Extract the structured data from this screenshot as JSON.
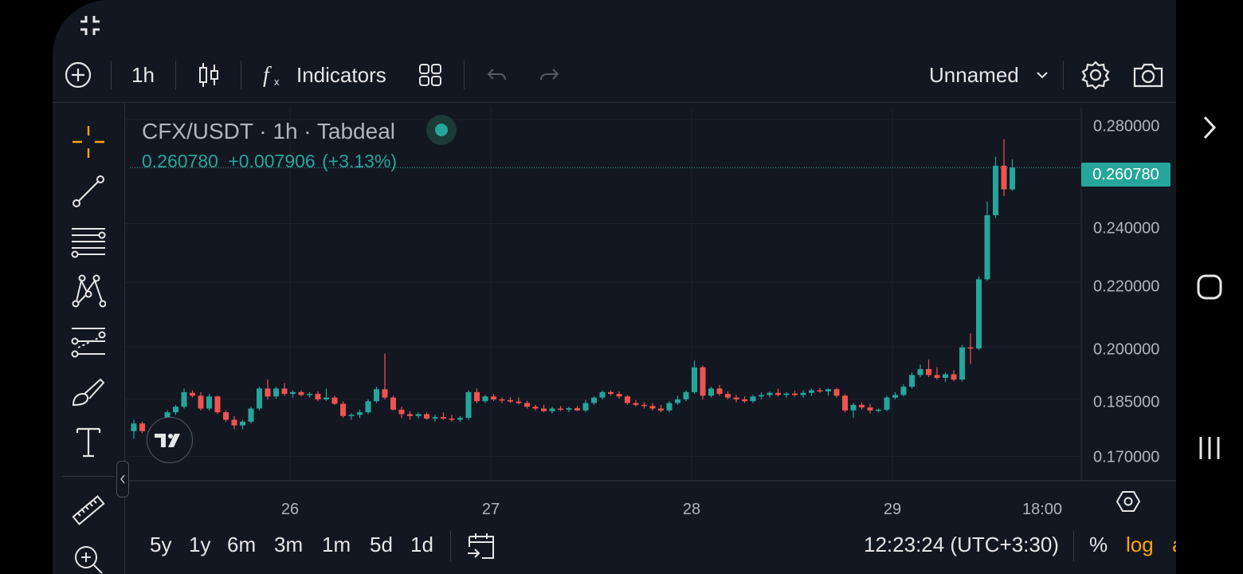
{
  "topbar": {
    "interval": "1h",
    "indicators_label": "Indicators",
    "layout_name": "Unnamed"
  },
  "legend": {
    "symbol": "CFX/USDT · 1h · Tabdeal",
    "last": "0.260780",
    "change": "+0.007906",
    "change_pct": "(+3.13%)"
  },
  "price_axis": {
    "labels": [
      "0.280000",
      "0.240000",
      "0.220000",
      "0.200000",
      "0.185000",
      "0.170000"
    ],
    "last_price_tag": "0.260780",
    "scale": "log"
  },
  "time_axis": {
    "labels": [
      "26",
      "27",
      "28",
      "29",
      "18:00"
    ]
  },
  "bottombar": {
    "ranges": [
      "5y",
      "1y",
      "6m",
      "3m",
      "1m",
      "5d",
      "1d"
    ],
    "clock": "12:23:24 (UTC+3:30)",
    "percent_label": "%",
    "log_label": "log",
    "auto_label": "auto"
  },
  "colors": {
    "up": "#26a69a",
    "down": "#ef5350",
    "background": "#131722",
    "accent": "#f7a600"
  },
  "icons": {
    "left_toolbar": [
      "crosshair-icon",
      "trend-line-icon",
      "fib-levels-icon",
      "pattern-icon",
      "prediction-icon",
      "brush-icon",
      "text-icon",
      "ruler-icon",
      "zoom-in-icon"
    ],
    "top_toolbar": [
      "add-symbol-icon",
      "candles-icon",
      "fx-icon",
      "templates-icon",
      "undo-icon",
      "redo-icon",
      "settings-icon",
      "camera-icon"
    ],
    "system": [
      "minimize-icon",
      "chevron-right-icon",
      "home-icon",
      "recents-icon"
    ]
  },
  "chart_data": {
    "type": "candlestick",
    "symbol": "CFX/USDT",
    "interval": "1h",
    "exchange": "Tabdeal",
    "xlabel": "",
    "ylabel": "",
    "ylim": [
      0.164,
      0.285
    ],
    "y_scale": "log",
    "x_tick_labels": [
      "26",
      "27",
      "28",
      "29",
      "18:00"
    ],
    "y_tick_labels": [
      "0.170000",
      "0.185000",
      "0.200000",
      "0.220000",
      "0.240000",
      "0.280000"
    ],
    "last_price": 0.26078,
    "candles": [
      [
        0.1765,
        0.1795,
        0.1745,
        0.1785
      ],
      [
        0.1785,
        0.179,
        0.176,
        0.1765
      ],
      [
        0.176,
        0.1772,
        0.175,
        0.1765
      ],
      [
        0.1765,
        0.178,
        0.1755,
        0.1775
      ],
      [
        0.1775,
        0.182,
        0.177,
        0.1815
      ],
      [
        0.1815,
        0.1835,
        0.1808,
        0.183
      ],
      [
        0.183,
        0.188,
        0.1825,
        0.187
      ],
      [
        0.1868,
        0.1875,
        0.1855,
        0.186
      ],
      [
        0.186,
        0.187,
        0.182,
        0.1825
      ],
      [
        0.1825,
        0.1865,
        0.182,
        0.1858
      ],
      [
        0.1858,
        0.186,
        0.181,
        0.1815
      ],
      [
        0.1815,
        0.182,
        0.179,
        0.1795
      ],
      [
        0.1795,
        0.1805,
        0.177,
        0.178
      ],
      [
        0.178,
        0.1795,
        0.177,
        0.179
      ],
      [
        0.179,
        0.183,
        0.1785,
        0.1825
      ],
      [
        0.1825,
        0.1885,
        0.182,
        0.188
      ],
      [
        0.188,
        0.1905,
        0.185,
        0.1858
      ],
      [
        0.1858,
        0.1885,
        0.1852,
        0.188
      ],
      [
        0.188,
        0.1895,
        0.186,
        0.1865
      ],
      [
        0.1865,
        0.1875,
        0.1855,
        0.187
      ],
      [
        0.187,
        0.1875,
        0.1858,
        0.1862
      ],
      [
        0.1862,
        0.187,
        0.1855,
        0.1865
      ],
      [
        0.1865,
        0.1872,
        0.1845,
        0.185
      ],
      [
        0.185,
        0.188,
        0.1846,
        0.1855
      ],
      [
        0.1855,
        0.186,
        0.1835,
        0.1838
      ],
      [
        0.1838,
        0.1845,
        0.18,
        0.1805
      ],
      [
        0.1805,
        0.1812,
        0.1795,
        0.1808
      ],
      [
        0.1808,
        0.1822,
        0.18,
        0.1815
      ],
      [
        0.1815,
        0.185,
        0.181,
        0.1845
      ],
      [
        0.1845,
        0.1885,
        0.184,
        0.1878
      ],
      [
        0.1878,
        0.198,
        0.185,
        0.1855
      ],
      [
        0.1855,
        0.186,
        0.182,
        0.1822
      ],
      [
        0.1822,
        0.183,
        0.18,
        0.181
      ],
      [
        0.181,
        0.1818,
        0.1795,
        0.1805
      ],
      [
        0.1805,
        0.1815,
        0.1798,
        0.181
      ],
      [
        0.181,
        0.1815,
        0.1795,
        0.1798
      ],
      [
        0.1798,
        0.1808,
        0.179,
        0.1802
      ],
      [
        0.1802,
        0.1815,
        0.1795,
        0.1798
      ],
      [
        0.1798,
        0.1808,
        0.179,
        0.1795
      ],
      [
        0.1795,
        0.1805,
        0.179,
        0.18
      ],
      [
        0.18,
        0.1875,
        0.1795,
        0.187
      ],
      [
        0.187,
        0.188,
        0.184,
        0.1845
      ],
      [
        0.1845,
        0.1862,
        0.184,
        0.1858
      ],
      [
        0.1858,
        0.1865,
        0.1845,
        0.185
      ],
      [
        0.185,
        0.1855,
        0.184,
        0.1848
      ],
      [
        0.1848,
        0.1856,
        0.184,
        0.1844
      ],
      [
        0.1844,
        0.1855,
        0.1836,
        0.184
      ],
      [
        0.184,
        0.1846,
        0.1825,
        0.183
      ],
      [
        0.183,
        0.1835,
        0.182,
        0.1825
      ],
      [
        0.1825,
        0.1835,
        0.1815,
        0.1818
      ],
      [
        0.1818,
        0.183,
        0.1812,
        0.1825
      ],
      [
        0.1825,
        0.1832,
        0.1818,
        0.1822
      ],
      [
        0.1822,
        0.183,
        0.1815,
        0.1826
      ],
      [
        0.1826,
        0.1832,
        0.1818,
        0.182
      ],
      [
        0.182,
        0.1848,
        0.1815,
        0.184
      ],
      [
        0.184,
        0.1858,
        0.1835,
        0.1855
      ],
      [
        0.1855,
        0.1875,
        0.185,
        0.187
      ],
      [
        0.187,
        0.1875,
        0.186,
        0.1865
      ],
      [
        0.1865,
        0.1872,
        0.1852,
        0.1858
      ],
      [
        0.1858,
        0.1862,
        0.1835,
        0.184
      ],
      [
        0.184,
        0.1848,
        0.183,
        0.1835
      ],
      [
        0.1835,
        0.1842,
        0.1825,
        0.1832
      ],
      [
        0.1832,
        0.184,
        0.182,
        0.1825
      ],
      [
        0.1825,
        0.1835,
        0.1815,
        0.182
      ],
      [
        0.182,
        0.1845,
        0.1815,
        0.184
      ],
      [
        0.184,
        0.186,
        0.1835,
        0.185
      ],
      [
        0.185,
        0.1875,
        0.1845,
        0.187
      ],
      [
        0.187,
        0.196,
        0.1865,
        0.194
      ],
      [
        0.194,
        0.1945,
        0.185,
        0.186
      ],
      [
        0.186,
        0.1885,
        0.1855,
        0.188
      ],
      [
        0.188,
        0.189,
        0.186,
        0.1865
      ],
      [
        0.1865,
        0.1872,
        0.185,
        0.1855
      ],
      [
        0.1855,
        0.1862,
        0.1842,
        0.185
      ],
      [
        0.185,
        0.1858,
        0.184,
        0.1845
      ],
      [
        0.1845,
        0.1862,
        0.184,
        0.1858
      ],
      [
        0.1858,
        0.187,
        0.185,
        0.1862
      ],
      [
        0.1862,
        0.1872,
        0.1855,
        0.1868
      ],
      [
        0.1868,
        0.188,
        0.1858,
        0.1862
      ],
      [
        0.1862,
        0.187,
        0.1855,
        0.1866
      ],
      [
        0.1866,
        0.1874,
        0.1858,
        0.1862
      ],
      [
        0.1862,
        0.1875,
        0.1855,
        0.1868
      ],
      [
        0.1868,
        0.188,
        0.186,
        0.1875
      ],
      [
        0.1875,
        0.1882,
        0.1868,
        0.1872
      ],
      [
        0.1872,
        0.188,
        0.186,
        0.1878
      ],
      [
        0.1878,
        0.1882,
        0.1855,
        0.186
      ],
      [
        0.186,
        0.1865,
        0.1815,
        0.182
      ],
      [
        0.182,
        0.184,
        0.18,
        0.1835
      ],
      [
        0.1835,
        0.1842,
        0.1822,
        0.1828
      ],
      [
        0.1828,
        0.1838,
        0.1812,
        0.182
      ],
      [
        0.182,
        0.1825,
        0.1815,
        0.1822
      ],
      [
        0.1822,
        0.186,
        0.1818,
        0.1855
      ],
      [
        0.1855,
        0.187,
        0.185,
        0.1862
      ],
      [
        0.1862,
        0.1892,
        0.1858,
        0.1885
      ],
      [
        0.1885,
        0.1925,
        0.188,
        0.1918
      ],
      [
        0.1918,
        0.1948,
        0.1912,
        0.1935
      ],
      [
        0.1935,
        0.1962,
        0.1912,
        0.1918
      ],
      [
        0.1918,
        0.194,
        0.1905,
        0.191
      ],
      [
        0.191,
        0.1925,
        0.1898,
        0.192
      ],
      [
        0.192,
        0.1932,
        0.19,
        0.1905
      ],
      [
        0.1905,
        0.2005,
        0.19,
        0.1998
      ],
      [
        0.1998,
        0.204,
        0.195,
        0.1995
      ],
      [
        0.1995,
        0.222,
        0.199,
        0.221
      ],
      [
        0.221,
        0.248,
        0.2205,
        0.243
      ],
      [
        0.243,
        0.265,
        0.242,
        0.2615
      ],
      [
        0.2615,
        0.272,
        0.25,
        0.2525
      ],
      [
        0.2525,
        0.264,
        0.252,
        0.2608
      ]
    ]
  }
}
